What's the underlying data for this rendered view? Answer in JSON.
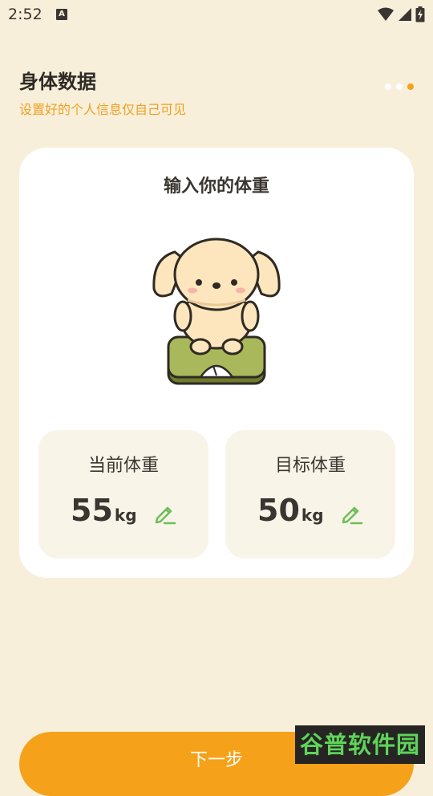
{
  "status_bar": {
    "time": "2:52",
    "notification_letter": "A"
  },
  "header": {
    "title": "身体数据",
    "subtitle": "设置好的个人信息仅自己可见",
    "step_indicator": {
      "steps": 3,
      "active_index": 2
    }
  },
  "card": {
    "title": "输入你的体重",
    "current": {
      "label": "当前体重",
      "value": "55",
      "unit": "kg"
    },
    "target": {
      "label": "目标体重",
      "value": "50",
      "unit": "kg"
    }
  },
  "footer": {
    "next_label": "下一步"
  },
  "watermark": {
    "text": "谷普软件园"
  },
  "colors": {
    "background": "#f8efdb",
    "accent": "#f5a11a",
    "subtitle": "#f0a020",
    "edit_icon": "#6cbf5a"
  }
}
